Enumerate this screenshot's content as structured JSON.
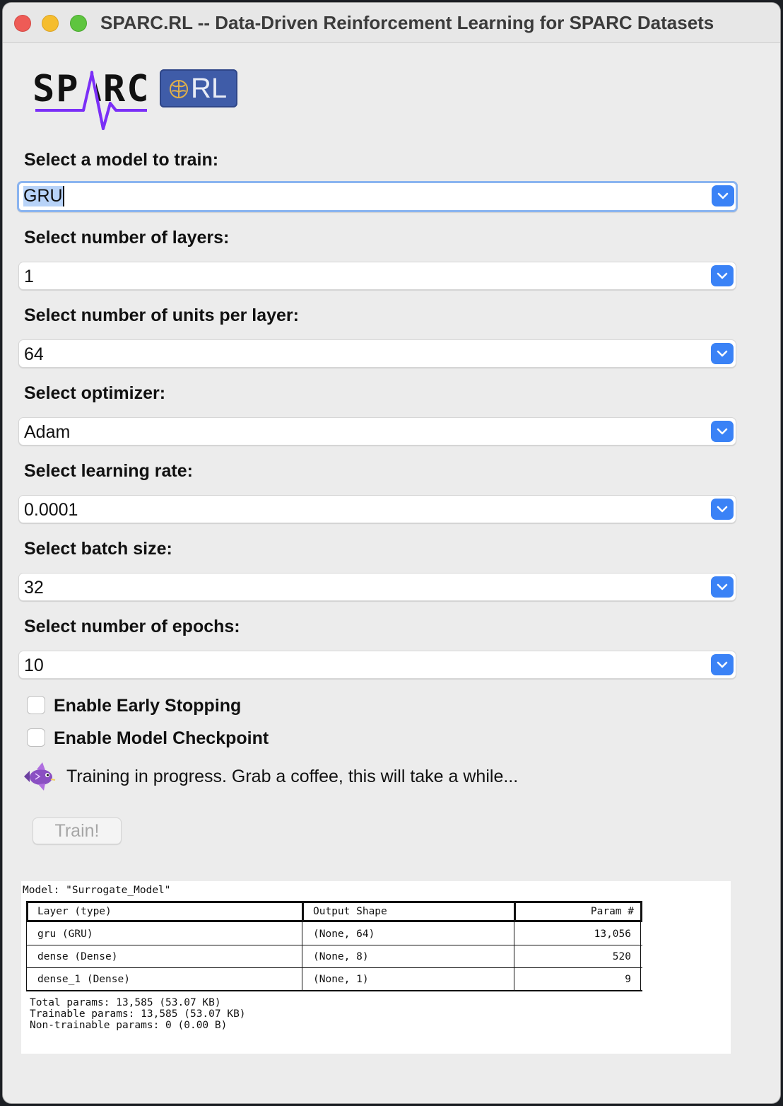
{
  "window": {
    "title": "SPARC.RL -- Data-Driven Reinforcement Learning for SPARC Datasets"
  },
  "logo": {
    "sparc_text": "SPARC",
    "badge_text": "RL",
    "colors": {
      "wave": "#7b2ff7",
      "badge": "#3f5ca8"
    }
  },
  "form": {
    "model": {
      "label": "Select a model to train:",
      "value": "GRU"
    },
    "layers": {
      "label": "Select number of layers:",
      "value": "1"
    },
    "units": {
      "label": "Select number of units per layer:",
      "value": "64"
    },
    "optimizer": {
      "label": "Select optimizer:",
      "value": "Adam"
    },
    "learning_rate": {
      "label": "Select learning rate:",
      "value": "0.0001"
    },
    "batch_size": {
      "label": "Select batch size:",
      "value": "32"
    },
    "epochs": {
      "label": "Select number of epochs:",
      "value": "10"
    },
    "early_stopping": {
      "label": "Enable Early Stopping",
      "checked": false
    },
    "checkpoint": {
      "label": "Enable Model Checkpoint",
      "checked": false
    }
  },
  "status": {
    "icon": "fish-icon",
    "text": "Training in progress. Grab a coffee, this will take a while..."
  },
  "train_button": {
    "label": "Train!",
    "enabled": false
  },
  "model_summary": {
    "title": "Model: \"Surrogate_Model\"",
    "columns": [
      "Layer (type)",
      "Output Shape",
      "Param #"
    ],
    "rows": [
      {
        "layer": "gru (GRU)",
        "shape": "(None, 64)",
        "params": "13,056"
      },
      {
        "layer": "dense (Dense)",
        "shape": "(None, 8)",
        "params": "520"
      },
      {
        "layer": "dense_1 (Dense)",
        "shape": "(None, 1)",
        "params": "9"
      }
    ],
    "total": "Total params: 13,585 (53.07 KB)",
    "trainable": "Trainable params: 13,585 (53.07 KB)",
    "non_trainable": "Non-trainable params: 0 (0.00 B)"
  },
  "colors": {
    "accent": "#3a82f6",
    "focus_ring": "#8ab4f0"
  }
}
